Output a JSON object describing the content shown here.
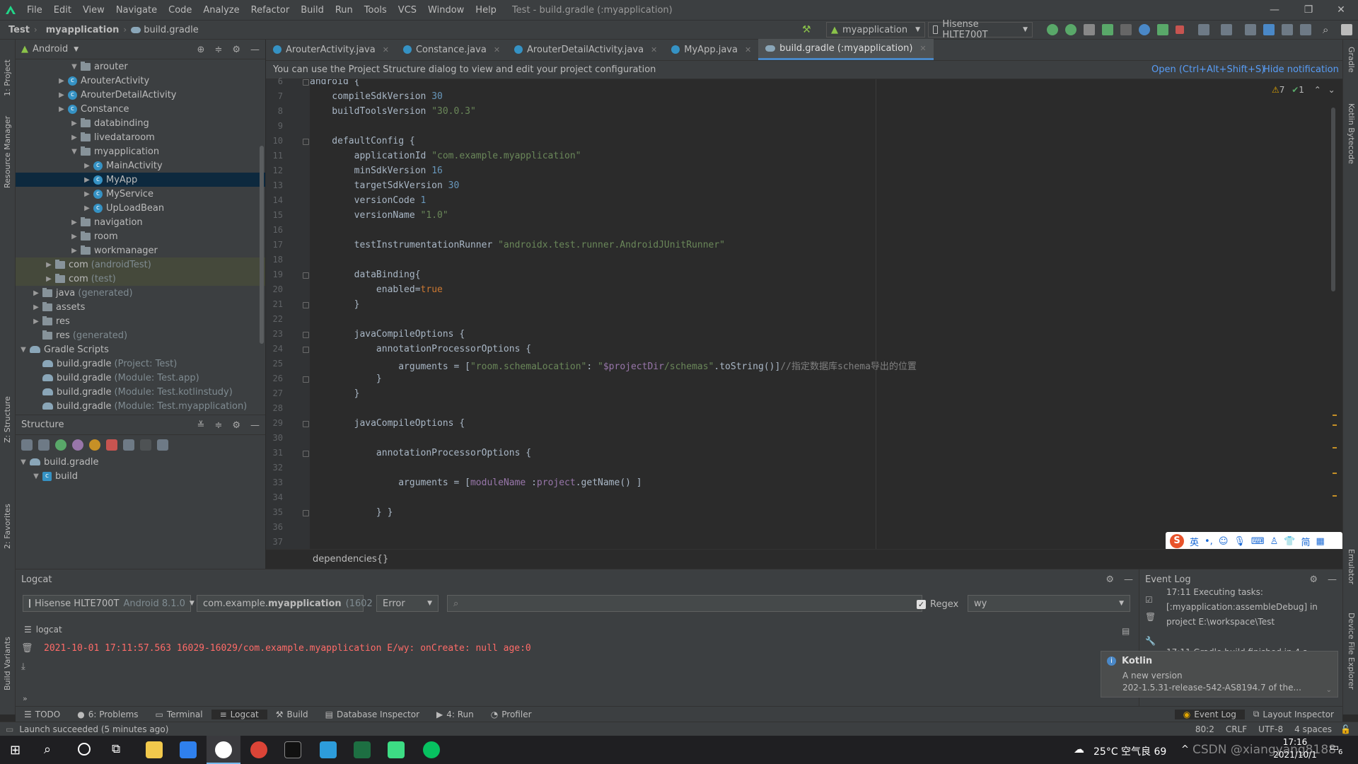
{
  "menubar": {
    "items": [
      "File",
      "Edit",
      "View",
      "Navigate",
      "Code",
      "Analyze",
      "Refactor",
      "Build",
      "Run",
      "Tools",
      "VCS",
      "Window",
      "Help"
    ],
    "title": "Test - build.gradle (:myapplication)"
  },
  "navbar": {
    "crumbs": [
      "Test",
      "myapplication",
      "build.gradle"
    ],
    "run_config": "myapplication",
    "device": "Hisense HLTE700T"
  },
  "project_panel": {
    "view_selector": "Android",
    "tree": [
      {
        "label": "arouter",
        "type": "folder",
        "expanded": true
      },
      {
        "label": "ArouterActivity",
        "type": "class"
      },
      {
        "label": "ArouterDetailActivity",
        "type": "class"
      },
      {
        "label": "Constance",
        "type": "class"
      },
      {
        "label": "databinding",
        "type": "folder"
      },
      {
        "label": "livedataroom",
        "type": "folder"
      },
      {
        "label": "myapplication",
        "type": "folder",
        "expanded": true
      },
      {
        "label": "MainActivity",
        "type": "class"
      },
      {
        "label": "MyApp",
        "type": "class",
        "selected": true
      },
      {
        "label": "MyService",
        "type": "class"
      },
      {
        "label": "UpLoadBean",
        "type": "class"
      },
      {
        "label": "navigation",
        "type": "folder"
      },
      {
        "label": "room",
        "type": "folder"
      },
      {
        "label": "workmanager",
        "type": "folder"
      },
      {
        "label": "com",
        "suffix": "(androidTest)",
        "type": "folder"
      },
      {
        "label": "com",
        "suffix": "(test)",
        "type": "folder"
      },
      {
        "label": "java",
        "suffix": "(generated)",
        "type": "folder"
      },
      {
        "label": "assets",
        "type": "folder"
      },
      {
        "label": "res",
        "type": "folder"
      },
      {
        "label": "res",
        "suffix": "(generated)",
        "type": "folder"
      },
      {
        "label": "Gradle Scripts",
        "type": "gradle-group",
        "expanded": true
      },
      {
        "label": "build.gradle",
        "suffix": "(Project: Test)",
        "type": "gradle"
      },
      {
        "label": "build.gradle",
        "suffix": "(Module: Test.app)",
        "type": "gradle"
      },
      {
        "label": "build.gradle",
        "suffix": "(Module: Test.kotlinstudy)",
        "type": "gradle"
      },
      {
        "label": "build.gradle",
        "suffix": "(Module: Test.myapplication)",
        "type": "gradle"
      }
    ]
  },
  "structure_panel": {
    "title": "Structure",
    "tree": [
      {
        "label": "build.gradle"
      },
      {
        "label": "build"
      }
    ]
  },
  "editor": {
    "tabs": [
      {
        "label": "ArouterActivity.java"
      },
      {
        "label": "Constance.java"
      },
      {
        "label": "ArouterDetailActivity.java"
      },
      {
        "label": "MyApp.java"
      },
      {
        "label": "build.gradle (:myapplication)",
        "active": true
      }
    ],
    "notification": "You can use the Project Structure dialog to view and edit your project configuration",
    "notification_open": "Open (Ctrl+Alt+Shift+S)",
    "notification_hide": "Hide notification",
    "warnings": "7",
    "ok_count": "1",
    "line_numbers": [
      "6",
      "7",
      "8",
      "9",
      "10",
      "11",
      "12",
      "13",
      "14",
      "15",
      "16",
      "17",
      "18",
      "19",
      "20",
      "21",
      "22",
      "23",
      "24",
      "25",
      "26",
      "27",
      "28",
      "29",
      "30",
      "31",
      "32",
      "33",
      "34",
      "35",
      "36",
      "37"
    ],
    "breadcrumb": "dependencies{}"
  },
  "logcat": {
    "title": "Logcat",
    "device": "Hisense HLTE700T",
    "device_suffix": "Android 8.1.0",
    "process_prefix": "com.example.",
    "process_bold": "myapplication",
    "process_pid": "(1602",
    "level": "Error",
    "search_placeholder": "",
    "regex_label": "Regex",
    "filter": "wy",
    "subtab": "logcat",
    "line": "2021-10-01 17:11:57.563 16029-16029/com.example.myapplication E/wy: onCreate: null age:0"
  },
  "event_log": {
    "title": "Event Log",
    "line1": "17:11   Executing tasks:",
    "line2": "[:myapplication:assembleDebug] in",
    "line3": "project E:\\workspace\\Test",
    "line4": "17:11   Gradle build finished in 4 s",
    "popup_title": "Kotlin",
    "popup_line1": "A new version",
    "popup_line2": "202-1.5.31-release-542-AS8194.7 of the..."
  },
  "bottom_tabs": [
    "TODO",
    "6: Problems",
    "Terminal",
    "Logcat",
    "Build",
    "Database Inspector",
    "4: Run",
    "Profiler"
  ],
  "bottom_tabs_right": [
    "Event Log",
    "Layout Inspector"
  ],
  "left_tool_tabs": [
    "1: Project",
    "Resource Manager",
    "Z: Structure",
    "2: Favorites",
    "Build Variants"
  ],
  "right_tool_tabs": [
    "Gradle",
    "Kotlin Bytecode",
    "Emulator",
    "Device File Explorer"
  ],
  "status": {
    "message": "Launch succeeded (5 minutes ago)",
    "position": "80:2",
    "line_sep": "CRLF",
    "encoding": "UTF-8",
    "indent": "4 spaces"
  },
  "ime": {
    "label": "英"
  },
  "taskbar": {
    "weather": "25°C 空气良 69",
    "time": "17:16",
    "date": "2021/10/1",
    "watermark": "CSDN @xiangyang8188",
    "notif": "6"
  }
}
